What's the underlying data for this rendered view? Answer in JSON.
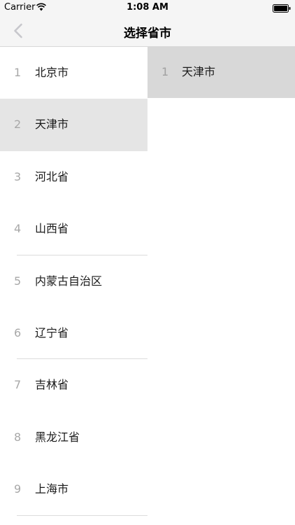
{
  "status_bar": {
    "carrier": "Carrier",
    "time": "1:08 AM",
    "wifi_icon": "wifi-icon",
    "battery_icon": "battery-icon"
  },
  "nav": {
    "title": "选择省市",
    "back_icon": "chevron-left-icon"
  },
  "left_list": {
    "selected_index": 1,
    "items": [
      {
        "num": "1",
        "label": "北京市"
      },
      {
        "num": "2",
        "label": "天津市"
      },
      {
        "num": "3",
        "label": "河北省"
      },
      {
        "num": "4",
        "label": "山西省"
      },
      {
        "num": "5",
        "label": "内蒙古自治区"
      },
      {
        "num": "6",
        "label": "辽宁省"
      },
      {
        "num": "7",
        "label": "吉林省"
      },
      {
        "num": "8",
        "label": "黑龙江省"
      },
      {
        "num": "9",
        "label": "上海市"
      }
    ]
  },
  "right_list": {
    "items": [
      {
        "num": "1",
        "label": "天津市"
      }
    ]
  },
  "colors": {
    "bar_background": "#f5f5f5",
    "selected_row": "#e5e5e5",
    "right_row": "#d8d8d8",
    "index_text": "#a8a8a8",
    "divider": "#dcdcdc",
    "back_chevron": "#c7c7cc"
  }
}
